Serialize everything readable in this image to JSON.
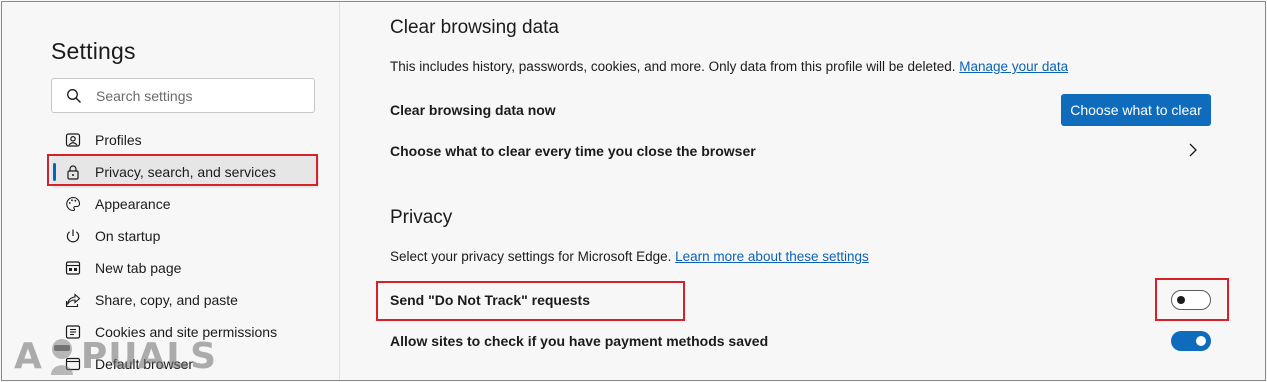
{
  "sidebar": {
    "title": "Settings",
    "search_placeholder": "Search settings",
    "items": [
      {
        "label": "Profiles",
        "icon": "profile-icon"
      },
      {
        "label": "Privacy, search, and services",
        "icon": "lock-icon",
        "active": true
      },
      {
        "label": "Appearance",
        "icon": "palette-icon"
      },
      {
        "label": "On startup",
        "icon": "power-icon"
      },
      {
        "label": "New tab page",
        "icon": "new-tab-icon"
      },
      {
        "label": "Share, copy, and paste",
        "icon": "share-icon"
      },
      {
        "label": "Cookies and site permissions",
        "icon": "cookies-icon"
      },
      {
        "label": "Default browser",
        "icon": "browser-icon"
      }
    ]
  },
  "clear_section": {
    "title": "Clear browsing data",
    "description": "This includes history, passwords, cookies, and more. Only data from this profile will be deleted.",
    "manage_link": "Manage your data",
    "row1_label": "Clear browsing data now",
    "row1_button": "Choose what to clear",
    "row2_label": "Choose what to clear every time you close the browser"
  },
  "privacy_section": {
    "title": "Privacy",
    "description": "Select your privacy settings for Microsoft Edge.",
    "learn_link": "Learn more about these settings",
    "dnt_label": "Send \"Do Not Track\" requests",
    "dnt_enabled": false,
    "payment_label": "Allow sites to check if you have payment methods saved",
    "payment_enabled": true
  },
  "watermark": {
    "text_left": "A",
    "text_right": "PUALS"
  },
  "colors": {
    "accent": "#0f6cbd",
    "link": "#0b62b8",
    "highlight": "#d6202a"
  }
}
